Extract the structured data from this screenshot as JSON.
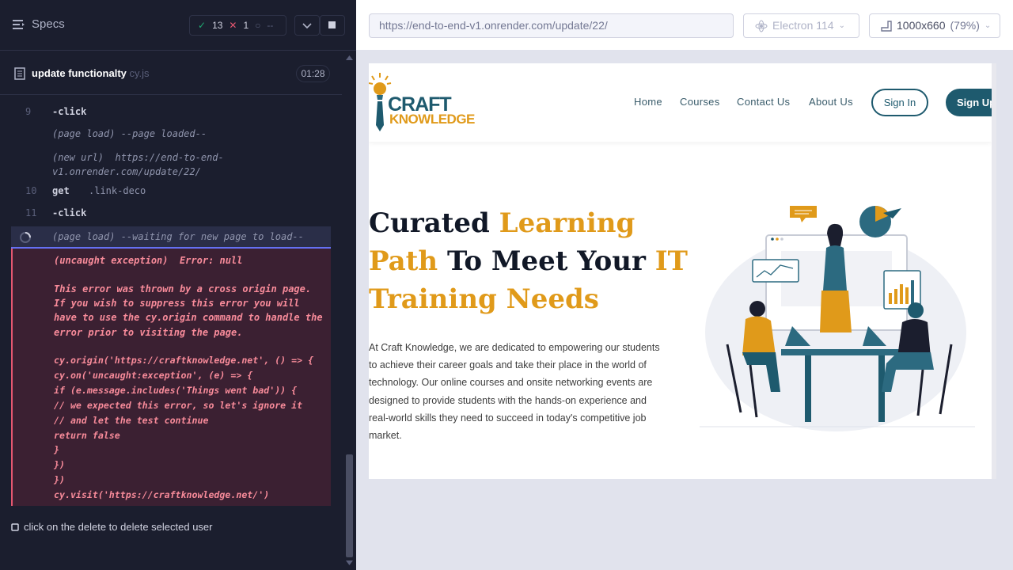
{
  "runner": {
    "specs_label": "Specs",
    "passed": "13",
    "failed": "1",
    "pending": "--",
    "file_name": "update functionalty",
    "file_ext": "cy.js",
    "duration": "01:28"
  },
  "log": {
    "rows": [
      {
        "num": "9",
        "cmd": "-click",
        "msg": ""
      },
      {
        "num": "",
        "cmd": "",
        "msg": "(page load)  --page loaded--"
      },
      {
        "num": "",
        "cmd": "",
        "msg": "(new url)  https://end-to-end-\nv1.onrender.com/update/22/"
      },
      {
        "num": "10",
        "cmd": "get",
        "msg": ".link-deco"
      },
      {
        "num": "11",
        "cmd": "-click",
        "msg": ""
      },
      {
        "num": "",
        "cmd": "",
        "msg": "(page load)  --waiting for new page to load--"
      }
    ],
    "error_title": "(uncaught exception)  Error: null",
    "error_body": "This error was thrown by a cross origin page. If you wish to suppress this error you will have to use the cy.origin command to handle the error prior to visiting the page.",
    "error_code": "cy.origin('https://craftknowledge.net', () => {\ncy.on('uncaught:exception', (e) => {\nif (e.message.includes('Things went bad')) {\n// we expected this error, so let's ignore it\n// and let the test continue\nreturn false\n}\n})\n})\ncy.visit('https://craftknowledge.net/')"
  },
  "footer": {
    "test_label": "click on the delete to delete selected user"
  },
  "browser": {
    "url": "https://end-to-end-v1.onrender.com/update/22/",
    "browser_label": "Electron 114",
    "viewport_label": "1000x660",
    "scale_label": "(79%)"
  },
  "site": {
    "logo_top": "CRAFT",
    "logo_bottom": "KNOWLEDGE",
    "nav": [
      "Home",
      "Courses",
      "Contact Us",
      "About Us"
    ],
    "signin": "Sign In",
    "signup": "Sign Up",
    "hero_a": "Curated ",
    "hero_b": "Learning",
    "hero_c": "Path",
    "hero_d": " To Meet Your ",
    "hero_e": "IT",
    "hero_f": "Training Needs",
    "paragraph": "At Craft Knowledge, we are dedicated to empowering our students to achieve their career goals and take their place in the world of technology. Our online courses and onsite networking events are designed to provide students with the hands-on experience and real-world skills they need to succeed in today's competitive job market."
  },
  "colors": {
    "accent": "#1e5a6e",
    "gold": "#e09a1a",
    "error": "#e45770",
    "pass": "#1fa971"
  }
}
